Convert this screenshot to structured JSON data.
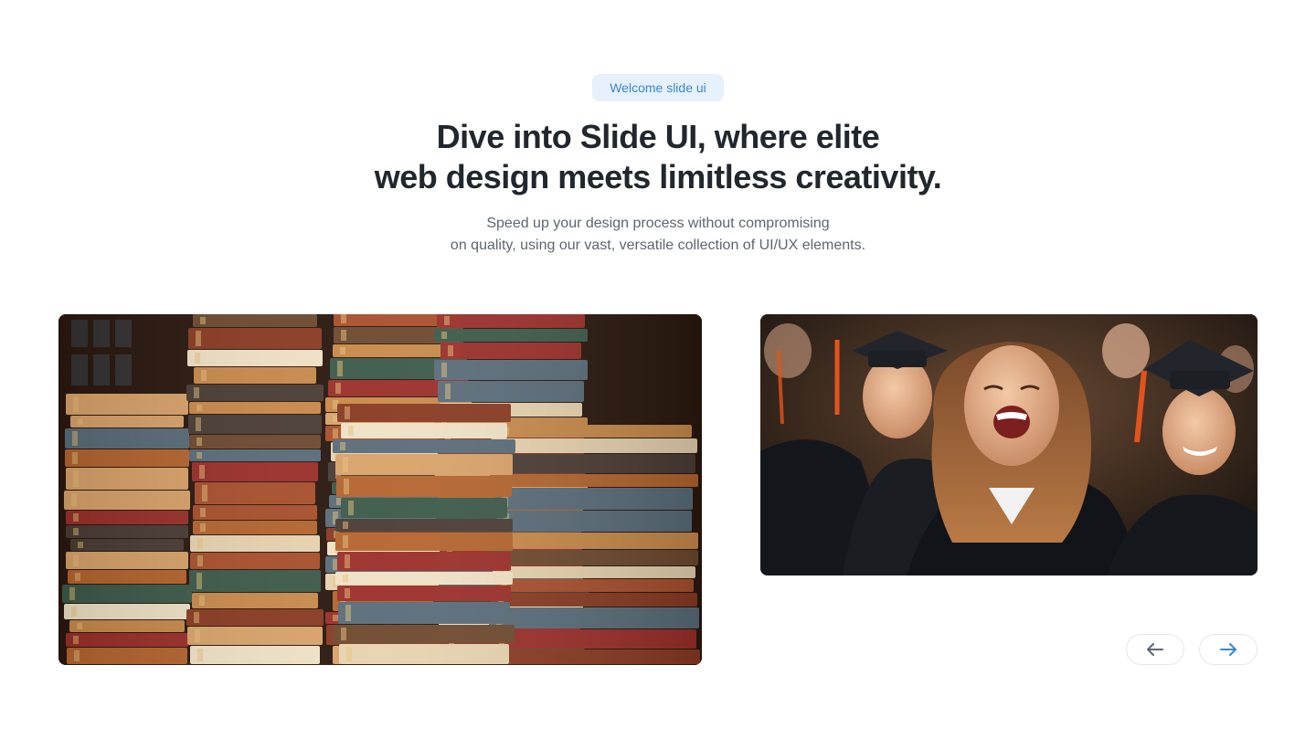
{
  "hero": {
    "badge": "Welcome slide ui",
    "headline_line1": "Dive into Slide UI, where elite",
    "headline_line2": "web design meets limitless creativity.",
    "subtext_line1": "Speed up your design process without compromising",
    "subtext_line2": "on quality, using our vast, versatile collection of UI/UX elements."
  },
  "carousel": {
    "slides": [
      {
        "name": "stacked-books-image"
      },
      {
        "name": "graduates-image"
      }
    ],
    "prev_icon": "arrow-left-icon",
    "next_icon": "arrow-right-icon"
  },
  "colors": {
    "badge_bg": "#e6f1fd",
    "badge_text": "#3b86d6",
    "headline": "#22272e",
    "subtext": "#5f6670",
    "next_arrow": "#3b86d6",
    "prev_arrow": "#5f6670"
  }
}
